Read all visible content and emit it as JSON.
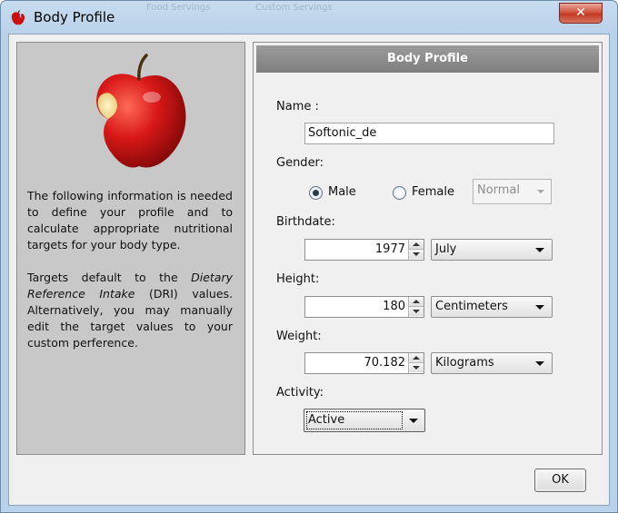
{
  "window": {
    "title": "Body Profile",
    "close_label": "✕",
    "ghost_tabs": [
      "Food Servings",
      "Custom Servings"
    ]
  },
  "info": {
    "para1": "The following information is needed to define your profile and to calculate appropriate nutritional targets for your body type.",
    "para2_before": "Targets default to the ",
    "para2_em": "Dietary Reference Intake",
    "para2_after": " (DRI) values. Alternatively, you may manually edit the target values to your custom perference."
  },
  "profile": {
    "header": "Body Profile",
    "name_label": "Name :",
    "name_value": "Softonic_de",
    "gender_label": "Gender:",
    "gender_options": [
      "Male",
      "Female"
    ],
    "gender_selected": "Male",
    "status_value": "Normal",
    "birthdate_label": "Birthdate:",
    "birth_year": "1977",
    "birth_month": "July",
    "height_label": "Height:",
    "height_value": "180",
    "height_unit": "Centimeters",
    "weight_label": "Weight:",
    "weight_value": "70.182",
    "weight_unit": "Kilograms",
    "activity_label": "Activity:",
    "activity_value": "Active"
  },
  "buttons": {
    "ok": "OK"
  },
  "colors": {
    "header_bg": "#8c8c8c",
    "left_panel_bg": "#c8c8c8",
    "apple_red": "#c40f0f",
    "window_frame": "#b9d1e9"
  },
  "icons": {
    "app": "apple-icon",
    "close": "close-icon",
    "spin": "spinner-arrows-icon",
    "dropdown": "chevron-down-icon"
  }
}
